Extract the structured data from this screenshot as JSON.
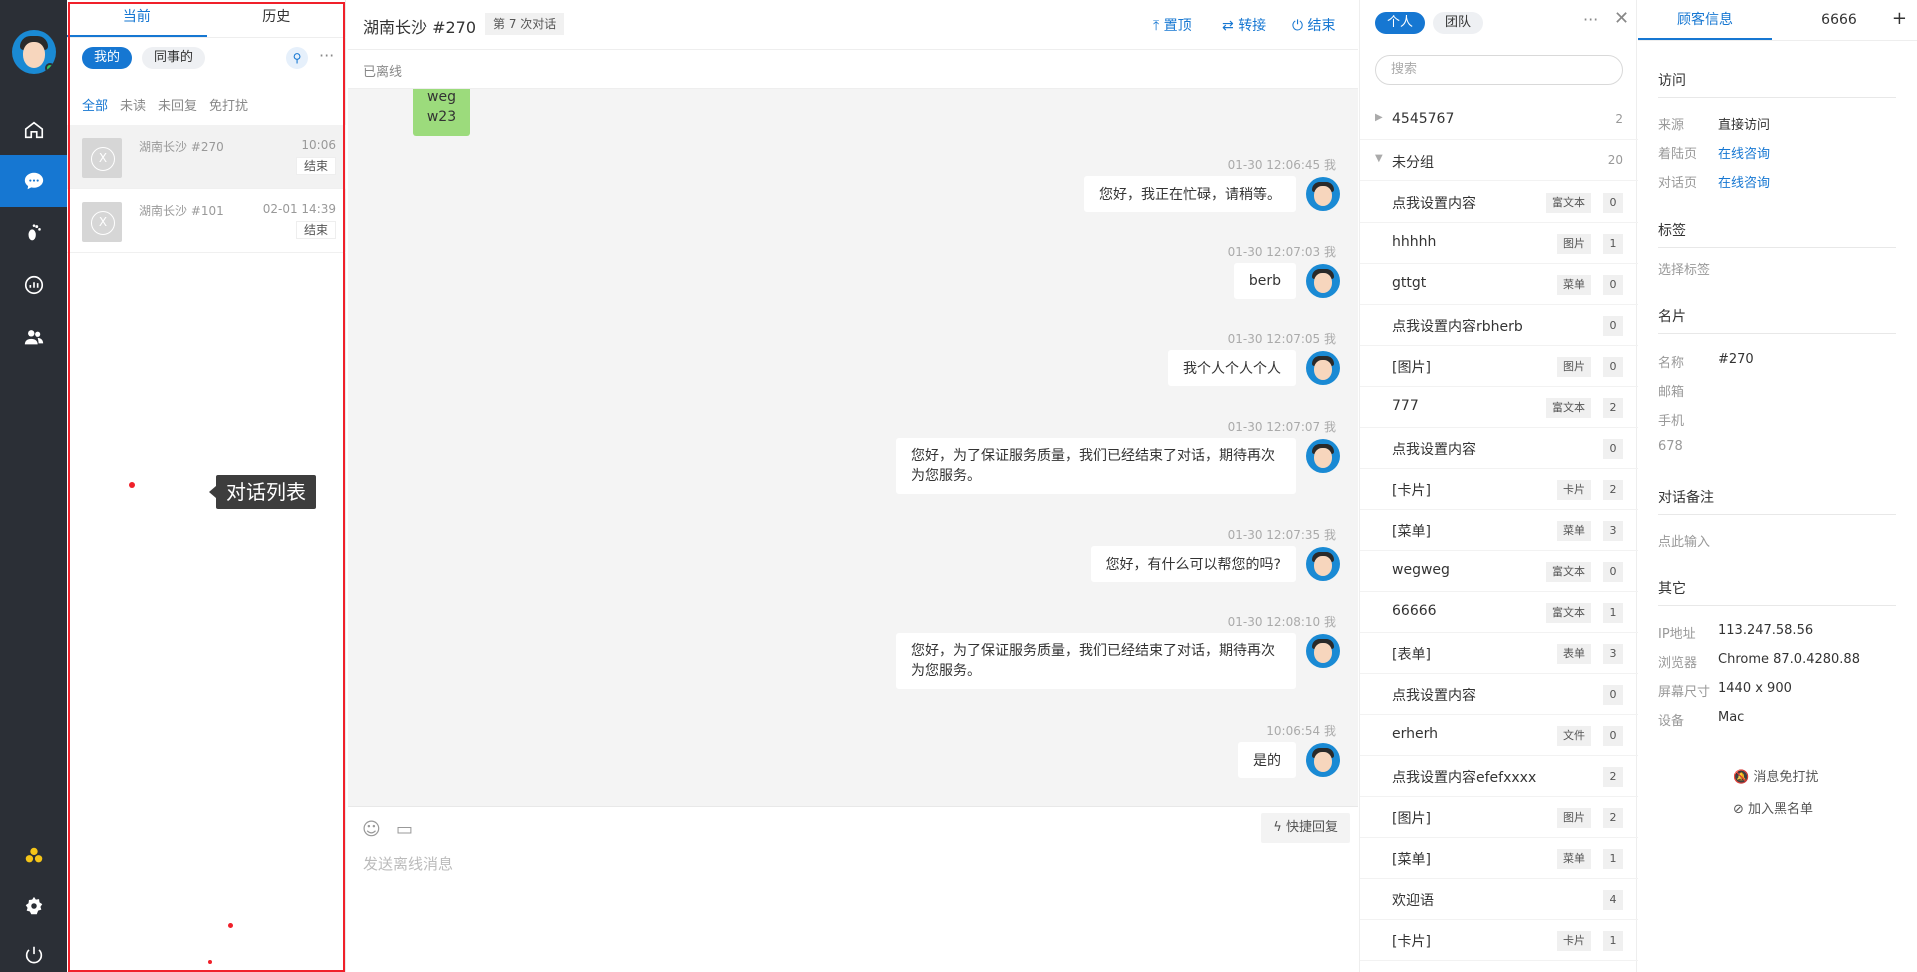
{
  "nav": {
    "items": [
      "home",
      "chat",
      "footprint",
      "stats",
      "users",
      "apps",
      "settings",
      "power"
    ]
  },
  "conversation_list": {
    "tabs": [
      "当前",
      "历史"
    ],
    "chips": [
      "我的",
      "同事的"
    ],
    "filters": [
      "全部",
      "未读",
      "未回复",
      "免打扰"
    ],
    "items": [
      {
        "title": "湖南长沙 #270",
        "time": "10:06",
        "tag": "结束"
      },
      {
        "title": "湖南长沙 #101",
        "time": "02-01 14:39",
        "tag": "结束"
      }
    ],
    "annotation": "对话列表"
  },
  "chat": {
    "title": "湖南长沙 #270",
    "badge": "第 7 次对话",
    "actions": [
      "置顶",
      "转接",
      "结束"
    ],
    "status": "已离线",
    "partial_message": "weg\nw23",
    "messages": [
      {
        "meta": "01-30 12:06:45 我",
        "text": "您好，我正在忙碌，请稍等。"
      },
      {
        "meta": "01-30 12:07:03 我",
        "text": "berb"
      },
      {
        "meta": "01-30 12:07:05 我",
        "text": "我个人个人个人"
      },
      {
        "meta": "01-30 12:07:07 我",
        "text": "您好，为了保证服务质量，我们已经结束了对话，期待再次为您服务。"
      },
      {
        "meta": "01-30 12:07:35 我",
        "text": "您好，有什么可以帮您的吗?"
      },
      {
        "meta": "01-30 12:08:10 我",
        "text": "您好，为了保证服务质量，我们已经结束了对话，期待再次为您服务。"
      },
      {
        "meta": "10:06:54 我",
        "text": "是的"
      }
    ],
    "quick_reply": "快捷回复",
    "input_placeholder": "发送离线消息"
  },
  "knowledge": {
    "tabs": [
      "个人",
      "团队"
    ],
    "search_placeholder": "搜索",
    "groups": [
      {
        "name": "4545767",
        "count": "2"
      },
      {
        "name": "未分组",
        "count": "20"
      }
    ],
    "items": [
      {
        "name": "点我设置内容",
        "type": "富文本",
        "count": "0"
      },
      {
        "name": "hhhhh",
        "type": "图片",
        "count": "1"
      },
      {
        "name": "gttgt",
        "type": "菜单",
        "count": "0"
      },
      {
        "name": "点我设置内容rbherb",
        "type": "",
        "count": "0"
      },
      {
        "name": "[图片]",
        "type": "图片",
        "count": "0"
      },
      {
        "name": "777",
        "type": "富文本",
        "count": "2"
      },
      {
        "name": "点我设置内容",
        "type": "",
        "count": "0"
      },
      {
        "name": "[卡片]",
        "type": "卡片",
        "count": "2"
      },
      {
        "name": "[菜单]",
        "type": "菜单",
        "count": "3"
      },
      {
        "name": "wegweg",
        "type": "富文本",
        "count": "0"
      },
      {
        "name": "66666",
        "type": "富文本",
        "count": "1"
      },
      {
        "name": "[表单]",
        "type": "表单",
        "count": "3"
      },
      {
        "name": "点我设置内容",
        "type": "",
        "count": "0"
      },
      {
        "name": "erherh",
        "type": "文件",
        "count": "0"
      },
      {
        "name": "点我设置内容efefxxxx",
        "type": "",
        "count": "2"
      },
      {
        "name": "[图片]",
        "type": "图片",
        "count": "2"
      },
      {
        "name": "[菜单]",
        "type": "菜单",
        "count": "1"
      },
      {
        "name": "欢迎语",
        "type": "",
        "count": "4"
      },
      {
        "name": "[卡片]",
        "type": "卡片",
        "count": "1"
      }
    ]
  },
  "customer": {
    "tabs": [
      "顾客信息",
      "6666"
    ],
    "visit": {
      "heading": "访问",
      "source_label": "来源",
      "source": "直接访问",
      "landing_label": "着陆页",
      "landing": "在线咨询",
      "chat_page_label": "对话页",
      "chat_page": "在线咨询"
    },
    "tags": {
      "heading": "标签",
      "placeholder": "选择标签"
    },
    "card": {
      "heading": "名片",
      "name_label": "名称",
      "name": "#270",
      "email_label": "邮箱",
      "phone_label": "手机",
      "extra": "678"
    },
    "note": {
      "heading": "对话备注",
      "placeholder": "点此输入"
    },
    "other": {
      "heading": "其它",
      "ip_label": "IP地址",
      "ip": "113.247.58.56",
      "browser_label": "浏览器",
      "browser": "Chrome 87.0.4280.88",
      "screen_label": "屏幕尺寸",
      "screen": "1440 x 900",
      "device_label": "设备",
      "device": "Mac"
    },
    "actions": [
      "消息免打扰",
      "加入黑名单"
    ]
  },
  "colors": {
    "accent": "#1677d2",
    "annotation_frame": "#f0202a",
    "nav_bg": "#2b2f36"
  }
}
